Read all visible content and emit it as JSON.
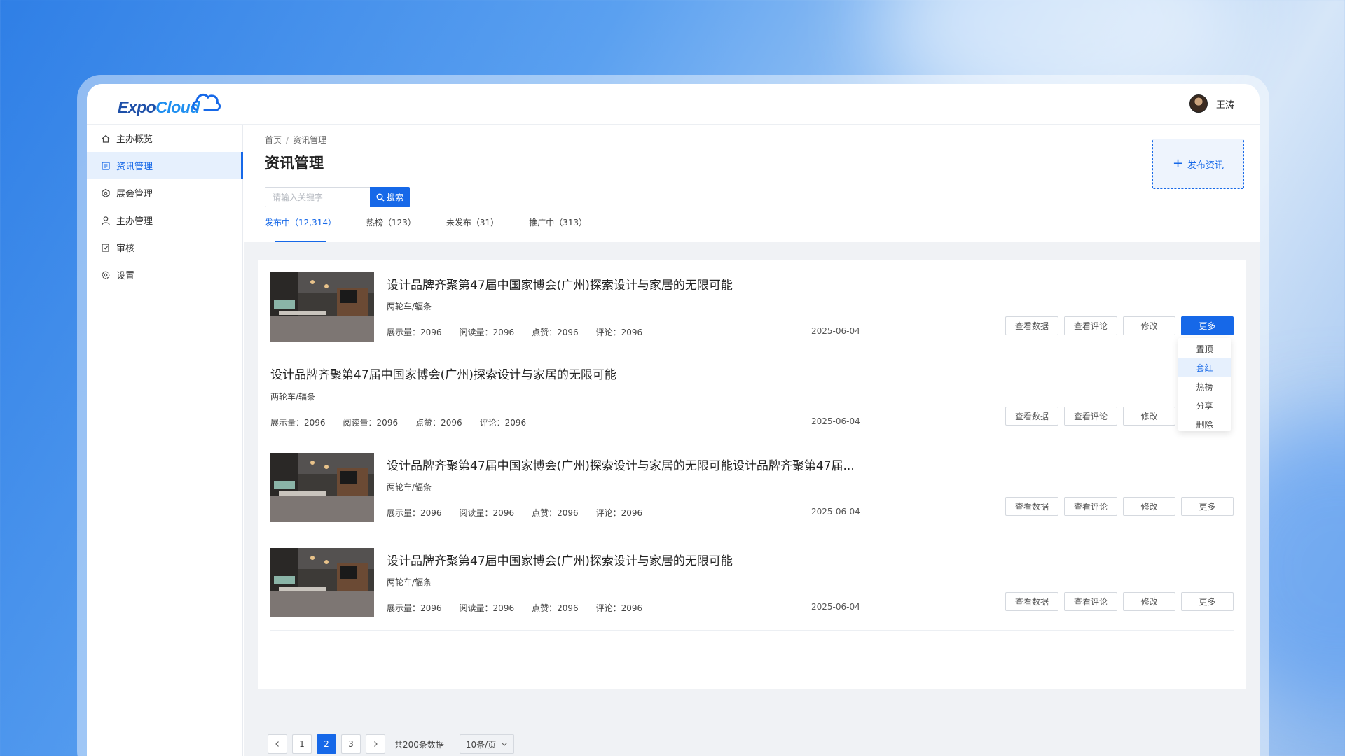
{
  "app": {
    "logo_text_a": "Expo",
    "logo_text_b": "Cloud",
    "user_name": "王涛",
    "brand_color": "#1668e8"
  },
  "sidebar": {
    "items": [
      {
        "label": "主办概览",
        "icon": "home-icon"
      },
      {
        "label": "资讯管理",
        "icon": "news-icon"
      },
      {
        "label": "展会管理",
        "icon": "expo-icon"
      },
      {
        "label": "主办管理",
        "icon": "user-icon"
      },
      {
        "label": "审核",
        "icon": "audit-icon"
      },
      {
        "label": "设置",
        "icon": "gear-icon"
      }
    ]
  },
  "header": {
    "breadcrumb_home": "首页",
    "breadcrumb_sep": "/",
    "breadcrumb_current": "资讯管理",
    "title": "资讯管理",
    "publish_label": "发布资讯"
  },
  "search": {
    "placeholder": "请输入关键字",
    "button_label": "搜索"
  },
  "tabs": [
    {
      "label": "发布中（12,314）"
    },
    {
      "label": "热榜（123）"
    },
    {
      "label": "未发布（31）"
    },
    {
      "label": "推广中（313）"
    }
  ],
  "articles": [
    {
      "title": "设计品牌齐聚第47届中国家博会(广州)探索设计与家居的无限可能",
      "category": "两轮车/辐条",
      "views": "展示量：2096",
      "reads": "阅读量：2096",
      "likes": "点赞：2096",
      "comments": "评论：2096",
      "date": "2025-06-04"
    },
    {
      "title": "设计品牌齐聚第47届中国家博会(广州)探索设计与家居的无限可能",
      "category": "两轮车/辐条",
      "views": "展示量：2096",
      "reads": "阅读量：2096",
      "likes": "点赞：2096",
      "comments": "评论：2096",
      "date": "2025-06-04"
    },
    {
      "title": "设计品牌齐聚第47届中国家博会(广州)探索设计与家居的无限可能设计品牌齐聚第47届...",
      "category": "两轮车/辐条",
      "views": "展示量：2096",
      "reads": "阅读量：2096",
      "likes": "点赞：2096",
      "comments": "评论：2096",
      "date": "2025-06-04"
    },
    {
      "title": "设计品牌齐聚第47届中国家博会(广州)探索设计与家居的无限可能",
      "category": "两轮车/辐条",
      "views": "展示量：2096",
      "reads": "阅读量：2096",
      "likes": "点赞：2096",
      "comments": "评论：2096",
      "date": "2025-06-04"
    }
  ],
  "actions": {
    "view_data": "查看数据",
    "view_comments": "查看评论",
    "edit": "修改",
    "more": "更多"
  },
  "more_menu": {
    "items": [
      "置顶",
      "套红",
      "热榜",
      "分享",
      "删除"
    ],
    "highlighted": "套红"
  },
  "pagination": {
    "pages": [
      "1",
      "2",
      "3"
    ],
    "current": "2",
    "total_text": "共200条数据",
    "page_size": "10条/页"
  }
}
